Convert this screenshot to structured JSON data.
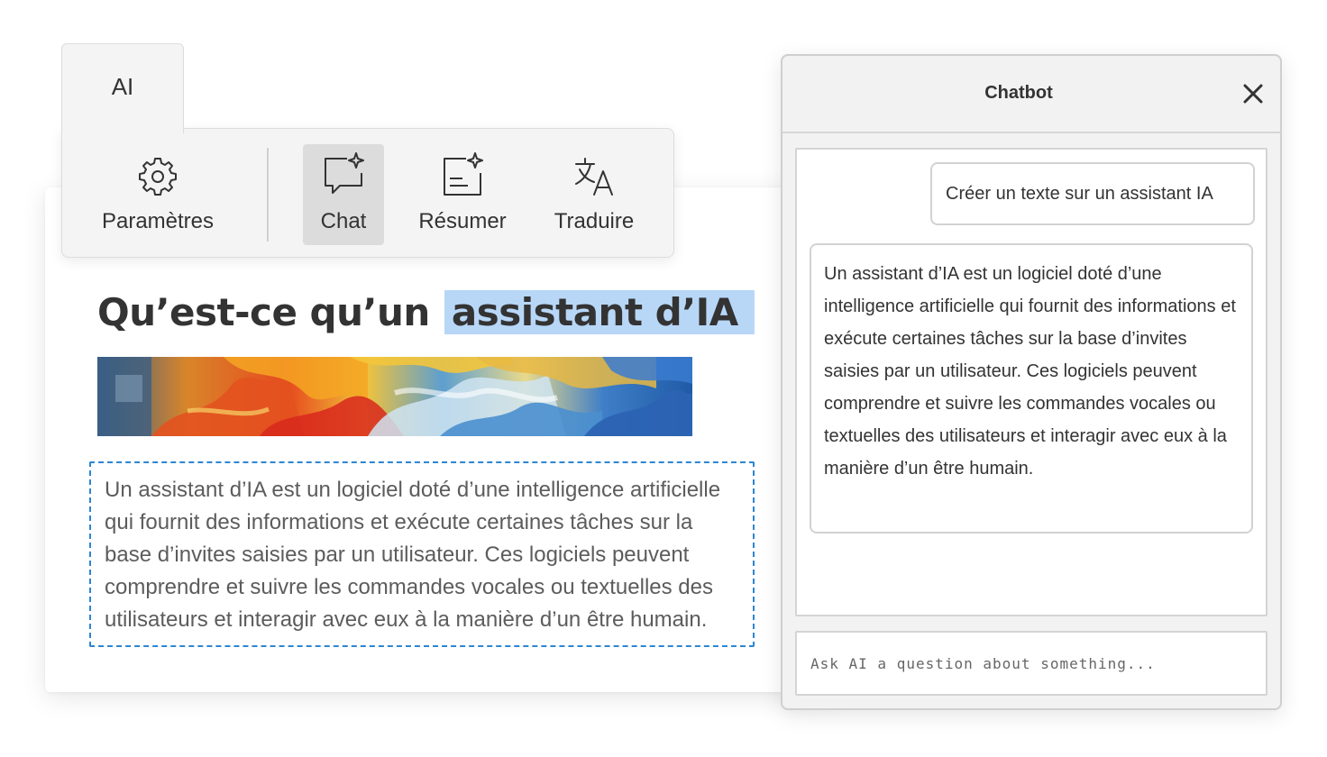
{
  "ribbon": {
    "tab_label": "AI",
    "buttons": [
      {
        "label": "Paramètres",
        "icon": "gear-icon"
      },
      {
        "label": "Chat",
        "icon": "chat-sparkle-icon",
        "active": true
      },
      {
        "label": "Résumer",
        "icon": "summarize-icon"
      },
      {
        "label": "Traduire",
        "icon": "translate-icon"
      }
    ]
  },
  "document": {
    "heading_plain": "Qu’est-ce qu’un",
    "heading_highlight": "assistant d’IA",
    "paragraph": "Un assistant d’IA est un logiciel doté d’une intelligence artificielle qui fournit des informations et exécute certaines tâches sur la base d’invites saisies par un utilisateur. Ces logiciels peuvent comprendre et suivre les commandes vocales ou textuelles des utilisateurs et interagir avec eux à la manière d’un être humain."
  },
  "chatbot": {
    "title": "Chatbot",
    "user_message": "Créer un texte sur un assistant IA",
    "bot_message": "Un assistant d’IA est un logiciel doté d’une intelligence artificielle qui fournit des informations et exécute certaines tâches sur la base d’invites saisies par un utilisateur. Ces logiciels peuvent comprendre et suivre les commandes vocales ou textuelles des utilisateurs et interagir avec eux à la manière d’un être humain.",
    "input_placeholder": "Ask AI a question about something...",
    "input_value": ""
  },
  "colors": {
    "highlight": "#b8d7f7",
    "selection_border": "#2d86d1",
    "ribbon_bg": "#f4f4f4",
    "active_button": "#dcdcdc"
  }
}
